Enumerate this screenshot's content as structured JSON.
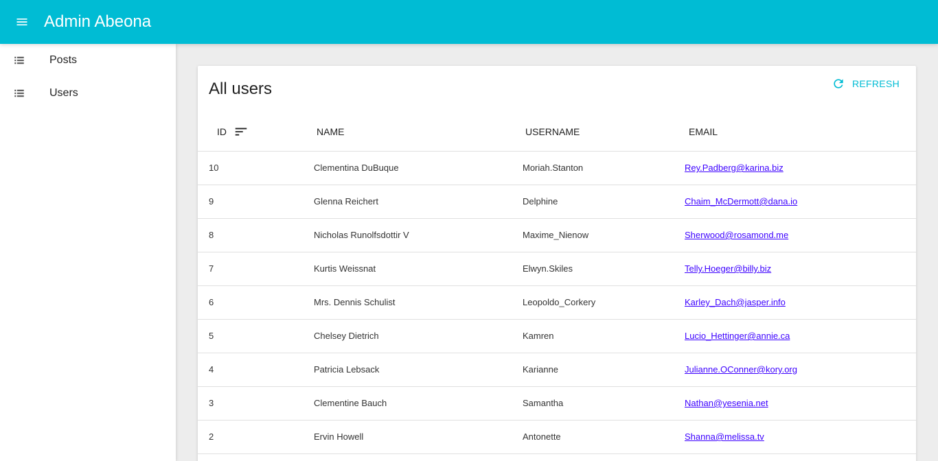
{
  "app": {
    "title": "Admin Abeona",
    "accent_color": "#00bcd4",
    "menu_icon": "menu-icon"
  },
  "sidebar": {
    "items": [
      {
        "label": "Posts",
        "icon": "list-icon"
      },
      {
        "label": "Users",
        "icon": "list-icon"
      }
    ]
  },
  "main": {
    "title": "All users",
    "refresh_label": "REFRESH",
    "columns": {
      "id": "ID",
      "name": "NAME",
      "username": "USERNAME",
      "email": "EMAIL"
    },
    "sort": {
      "column": "id",
      "icon": "sort-icon"
    },
    "rows": [
      {
        "id": "10",
        "name": "Clementina DuBuque",
        "username": "Moriah.Stanton",
        "email": "Rey.Padberg@karina.biz"
      },
      {
        "id": "9",
        "name": "Glenna Reichert",
        "username": "Delphine",
        "email": "Chaim_McDermott@dana.io"
      },
      {
        "id": "8",
        "name": "Nicholas Runolfsdottir V",
        "username": "Maxime_Nienow",
        "email": "Sherwood@rosamond.me"
      },
      {
        "id": "7",
        "name": "Kurtis Weissnat",
        "username": "Elwyn.Skiles",
        "email": "Telly.Hoeger@billy.biz"
      },
      {
        "id": "6",
        "name": "Mrs. Dennis Schulist",
        "username": "Leopoldo_Corkery",
        "email": "Karley_Dach@jasper.info"
      },
      {
        "id": "5",
        "name": "Chelsey Dietrich",
        "username": "Kamren",
        "email": "Lucio_Hettinger@annie.ca"
      },
      {
        "id": "4",
        "name": "Patricia Lebsack",
        "username": "Karianne",
        "email": "Julianne.OConner@kory.org"
      },
      {
        "id": "3",
        "name": "Clementine Bauch",
        "username": "Samantha",
        "email": "Nathan@yesenia.net"
      },
      {
        "id": "2",
        "name": "Ervin Howell",
        "username": "Antonette",
        "email": "Shanna@melissa.tv"
      }
    ]
  }
}
